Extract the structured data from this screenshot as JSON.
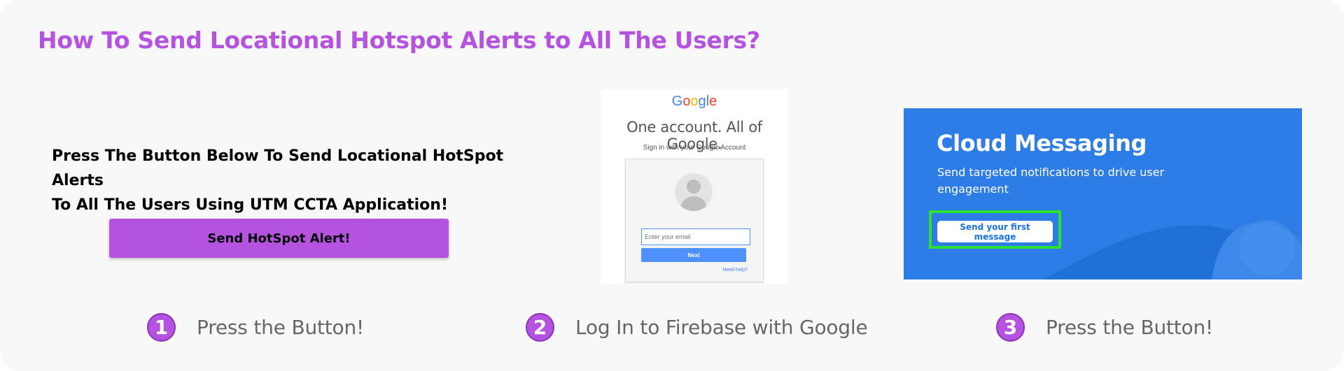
{
  "page": {
    "title": "How To Send Locational Hotspot Alerts to All The Users?",
    "intro_line1": "Press The Button Below To Send Locational HotSpot Alerts",
    "intro_line2": "To All The Users Using UTM CCTA Application!",
    "send_button_label": "Send HotSpot Alert!"
  },
  "google_panel": {
    "logo_letters": [
      {
        "ch": "G",
        "color": "#4285F4"
      },
      {
        "ch": "o",
        "color": "#EA4335"
      },
      {
        "ch": "o",
        "color": "#FBBC05"
      },
      {
        "ch": "g",
        "color": "#4285F4"
      },
      {
        "ch": "l",
        "color": "#34A853"
      },
      {
        "ch": "e",
        "color": "#EA4335"
      }
    ],
    "tagline": "One account. All of Google.",
    "subtitle": "Sign in with your Google Account",
    "email_placeholder": "Enter your email",
    "next_label": "Next",
    "help_link": "Need help?"
  },
  "cloud_panel": {
    "title": "Cloud Messaging",
    "description": "Send targeted notifications to drive user engagement",
    "button_label": "Send your first message",
    "highlight_color": "#2DE032",
    "background_color": "#2E7DE6"
  },
  "steps": [
    {
      "number": "1",
      "label": "Press the Button!"
    },
    {
      "number": "2",
      "label": "Log In to Firebase with Google"
    },
    {
      "number": "3",
      "label": "Press the Button!"
    }
  ],
  "colors": {
    "accent": "#B553E0",
    "card_background": "#F8F8F9",
    "step_label": "#666666"
  }
}
